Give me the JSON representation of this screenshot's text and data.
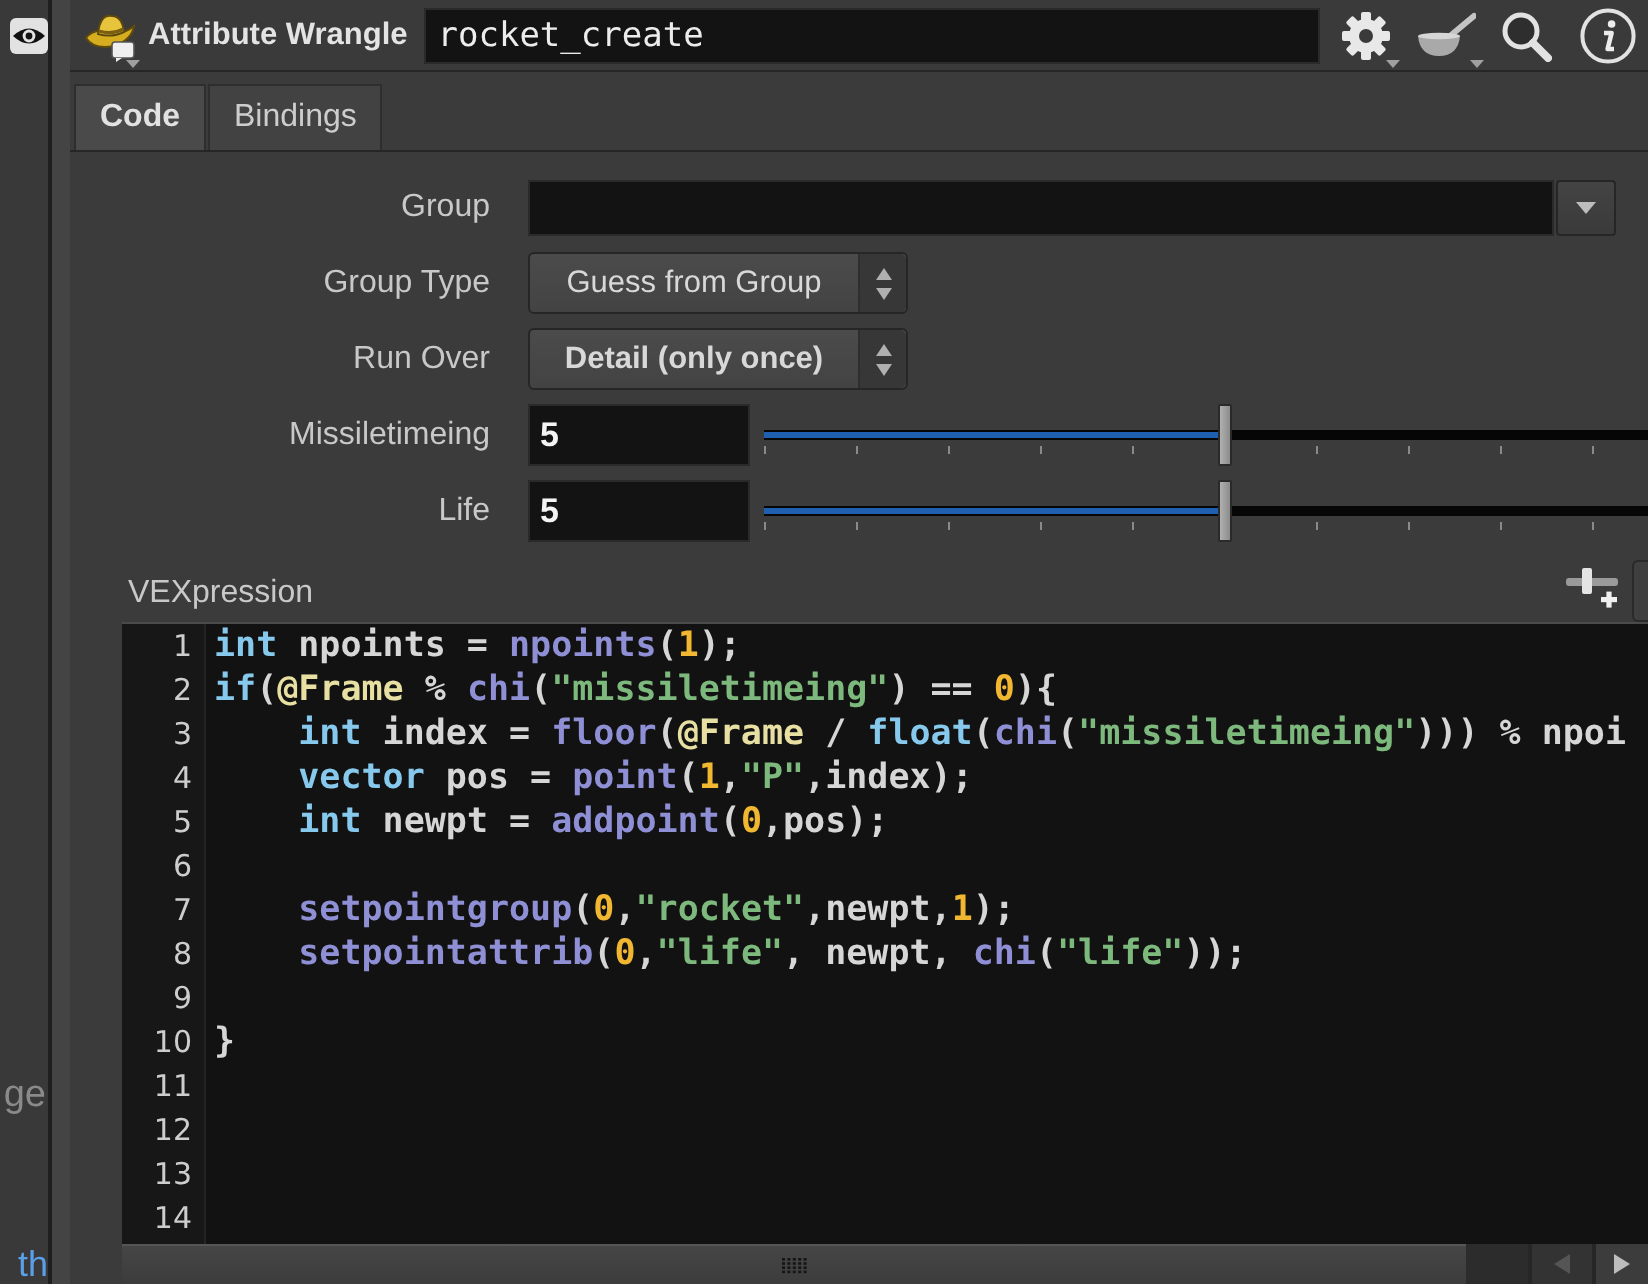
{
  "side_pane": {
    "fragments": [
      {
        "kind": "plain",
        "text": "ge"
      },
      {
        "kind": "link",
        "text": "th"
      }
    ]
  },
  "node": {
    "type": "Attribute Wrangle",
    "name": "rocket_create"
  },
  "tabs": [
    {
      "label": "Code",
      "selected": true
    },
    {
      "label": "Bindings",
      "selected": false
    }
  ],
  "parameters": [
    {
      "kind": "field_menu",
      "label": "Group"
    },
    {
      "kind": "menu",
      "label": "Group Type",
      "value": "Guess from Group",
      "modified": false
    },
    {
      "kind": "menu",
      "label": "Run Over",
      "value": "Detail (only once)",
      "modified": true
    },
    {
      "kind": "slider",
      "label": "Missiletimeing",
      "value": "5",
      "modified": true,
      "level": 0.52
    },
    {
      "kind": "slider",
      "label": "Life",
      "value": "5",
      "modified": true,
      "level": 0.52
    }
  ],
  "vexpression": {
    "label": "VEXpression",
    "lines": [
      {
        "number": "1",
        "tokens": [
          {
            "kind": "type",
            "text": "int"
          },
          {
            "kind": "plain",
            "text": " npoints = "
          },
          {
            "kind": "function",
            "text": "npoints"
          },
          {
            "kind": "plain",
            "text": "("
          },
          {
            "kind": "number",
            "text": "1"
          },
          {
            "kind": "plain",
            "text": ");"
          }
        ]
      },
      {
        "number": "2",
        "tokens": [
          {
            "kind": "type",
            "text": "if"
          },
          {
            "kind": "plain",
            "text": "("
          },
          {
            "kind": "attribute",
            "text": "@Frame"
          },
          {
            "kind": "plain",
            "text": " % "
          },
          {
            "kind": "function",
            "text": "chi"
          },
          {
            "kind": "plain",
            "text": "("
          },
          {
            "kind": "string",
            "text": "\"missiletimeing\""
          },
          {
            "kind": "plain",
            "text": ") == "
          },
          {
            "kind": "number",
            "text": "0"
          },
          {
            "kind": "plain",
            "text": "){"
          }
        ]
      },
      {
        "number": "3",
        "tokens": [
          {
            "kind": "type",
            "text": "    int"
          },
          {
            "kind": "plain",
            "text": " index = "
          },
          {
            "kind": "function",
            "text": "floor"
          },
          {
            "kind": "plain",
            "text": "("
          },
          {
            "kind": "attribute",
            "text": "@Frame"
          },
          {
            "kind": "plain",
            "text": " / "
          },
          {
            "kind": "type",
            "text": "float"
          },
          {
            "kind": "plain",
            "text": "("
          },
          {
            "kind": "function",
            "text": "chi"
          },
          {
            "kind": "plain",
            "text": "("
          },
          {
            "kind": "string",
            "text": "\"missiletimeing\""
          },
          {
            "kind": "plain",
            "text": "))) % npoi"
          }
        ]
      },
      {
        "number": "4",
        "tokens": [
          {
            "kind": "type",
            "text": "    vector"
          },
          {
            "kind": "plain",
            "text": " pos = "
          },
          {
            "kind": "function",
            "text": "point"
          },
          {
            "kind": "plain",
            "text": "("
          },
          {
            "kind": "number",
            "text": "1"
          },
          {
            "kind": "plain",
            "text": ","
          },
          {
            "kind": "string",
            "text": "\"P\""
          },
          {
            "kind": "plain",
            "text": ",index);"
          }
        ]
      },
      {
        "number": "5",
        "tokens": [
          {
            "kind": "type",
            "text": "    int"
          },
          {
            "kind": "plain",
            "text": " newpt = "
          },
          {
            "kind": "function",
            "text": "addpoint"
          },
          {
            "kind": "plain",
            "text": "("
          },
          {
            "kind": "number",
            "text": "0"
          },
          {
            "kind": "plain",
            "text": ",pos);"
          }
        ]
      },
      {
        "number": "6"
      },
      {
        "number": "7",
        "tokens": [
          {
            "kind": "function",
            "text": "    setpointgroup"
          },
          {
            "kind": "plain",
            "text": "("
          },
          {
            "kind": "number",
            "text": "0"
          },
          {
            "kind": "plain",
            "text": ","
          },
          {
            "kind": "string",
            "text": "\"rocket\""
          },
          {
            "kind": "plain",
            "text": ",newpt,"
          },
          {
            "kind": "number",
            "text": "1"
          },
          {
            "kind": "plain",
            "text": ");"
          }
        ]
      },
      {
        "number": "8",
        "tokens": [
          {
            "kind": "function",
            "text": "    setpointattrib"
          },
          {
            "kind": "plain",
            "text": "("
          },
          {
            "kind": "number",
            "text": "0"
          },
          {
            "kind": "plain",
            "text": ","
          },
          {
            "kind": "string",
            "text": "\"life\""
          },
          {
            "kind": "plain",
            "text": ", newpt, "
          },
          {
            "kind": "function",
            "text": "chi"
          },
          {
            "kind": "plain",
            "text": "("
          },
          {
            "kind": "string",
            "text": "\"life\""
          },
          {
            "kind": "plain",
            "text": "));"
          }
        ]
      },
      {
        "number": "9"
      },
      {
        "number": "10",
        "tokens": [
          {
            "kind": "plain",
            "text": "}"
          }
        ]
      },
      {
        "number": "11"
      },
      {
        "number": "12"
      },
      {
        "number": "13"
      },
      {
        "number": "14"
      }
    ]
  }
}
